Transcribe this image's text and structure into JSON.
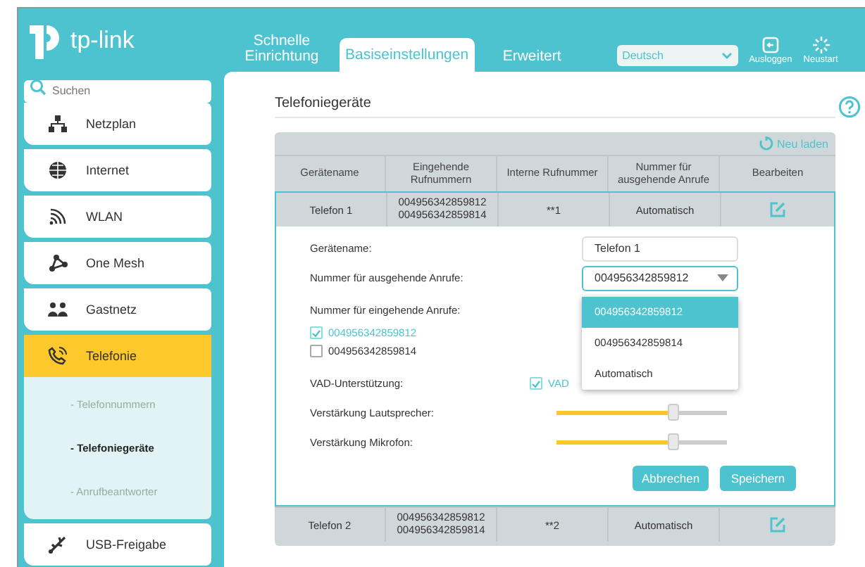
{
  "header": {
    "logo": "tp-link",
    "tabs": [
      {
        "label": "Schnelle Einrichtung",
        "selected": false
      },
      {
        "label": "Basiseinstellungen",
        "selected": true
      },
      {
        "label": "Erweitert",
        "selected": false
      }
    ],
    "language": "Deutsch",
    "actions": [
      {
        "kind": "logout",
        "label": "Ausloggen"
      },
      {
        "kind": "restart",
        "label": "Neustart"
      }
    ]
  },
  "sidebar": {
    "search": {
      "placeholder": "Suchen"
    },
    "items": [
      {
        "kind": "network",
        "label": "Netzplan",
        "selected": false
      },
      {
        "kind": "globe",
        "label": "Internet",
        "selected": false
      },
      {
        "kind": "wifi",
        "label": "WLAN",
        "selected": false
      },
      {
        "kind": "mesh",
        "label": "One Mesh",
        "selected": false
      },
      {
        "kind": "guests",
        "label": "Gastnetz",
        "selected": false
      },
      {
        "kind": "phone",
        "label": "Telefonie",
        "selected": true,
        "children": [
          {
            "label": "- Telefonnummern",
            "selected": false
          },
          {
            "label": "- Telefoniegeräte",
            "selected": true
          },
          {
            "label": "- Anrufbeantworter",
            "selected": false
          }
        ]
      },
      {
        "kind": "usb",
        "label": "USB-Freigabe",
        "selected": false
      }
    ]
  },
  "main": {
    "title": "Telefoniegeräte",
    "reload": "Neu laden",
    "table": {
      "columns": [
        "Gerätename",
        "Eingehende Rufnummern",
        "Interne Rufnummer",
        "Nummer für ausgehende Anrufe",
        "Bearbeiten"
      ],
      "rows": [
        {
          "name": "Telefon 1",
          "incoming": [
            "004956342859812",
            "004956342859814"
          ],
          "internal": "**1",
          "outgoing": "Automatisch",
          "expanded": true
        },
        {
          "name": "Telefon 2",
          "incoming": [
            "004956342859812",
            "004956342859814"
          ],
          "internal": "**2",
          "outgoing": "Automatisch",
          "expanded": false
        }
      ]
    },
    "editor": {
      "name_label": "Gerätename:",
      "name_value": "Telefon 1",
      "outgoing_label": "Nummer für ausgehende Anrufe:",
      "outgoing_value": "004956342859812",
      "outgoing_options": [
        {
          "label": "004956342859812",
          "selected": true
        },
        {
          "label": "004956342859814",
          "selected": false
        },
        {
          "label": "Automatisch",
          "selected": false
        }
      ],
      "incoming_label": "Nummer für eingehende Anrufe:",
      "incoming": [
        {
          "label": "004956342859812",
          "checked": true
        },
        {
          "label": "004956342859814",
          "checked": false
        }
      ],
      "vad_label": "VAD-Unterstützung:",
      "vad": {
        "label": "VAD",
        "checked": true
      },
      "sliders": [
        {
          "label": "Verstärkung Lautsprecher:",
          "level": 0.69
        },
        {
          "label": "Verstärkung Mikrofon:",
          "level": 0.69
        }
      ],
      "buttons": [
        "Abbrechen",
        "Speichern"
      ]
    }
  }
}
